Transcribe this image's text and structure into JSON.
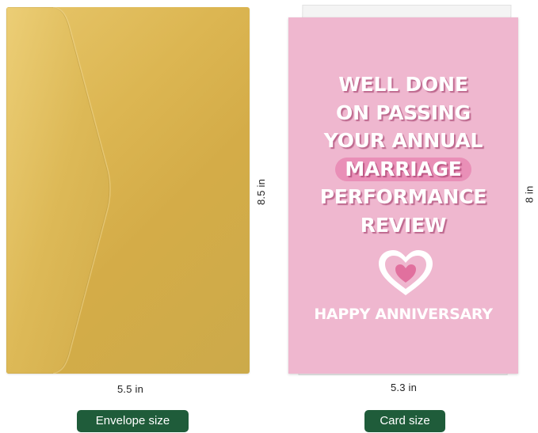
{
  "envelope": {
    "height_label": "8.5 in",
    "width_label": "5.5 in",
    "caption": "Envelope size"
  },
  "card": {
    "title_lines": [
      "WELL DONE",
      "ON PASSING",
      "YOUR ANNUAL",
      "MARRIAGE",
      "PERFORMANCE",
      "REVIEW"
    ],
    "subtitle": "HAPPY ANNIVERSARY",
    "height_label": "8 in",
    "width_label": "5.3 in",
    "caption": "Card size"
  },
  "colors": {
    "envelope_gold": "#d9b453",
    "card_pink": "#efb7cf",
    "highlight_pink": "#e98fb7",
    "heart_pink": "#e1709e",
    "caption_green": "#1f5c3a"
  },
  "icons": {
    "heart": "heart-icon"
  }
}
